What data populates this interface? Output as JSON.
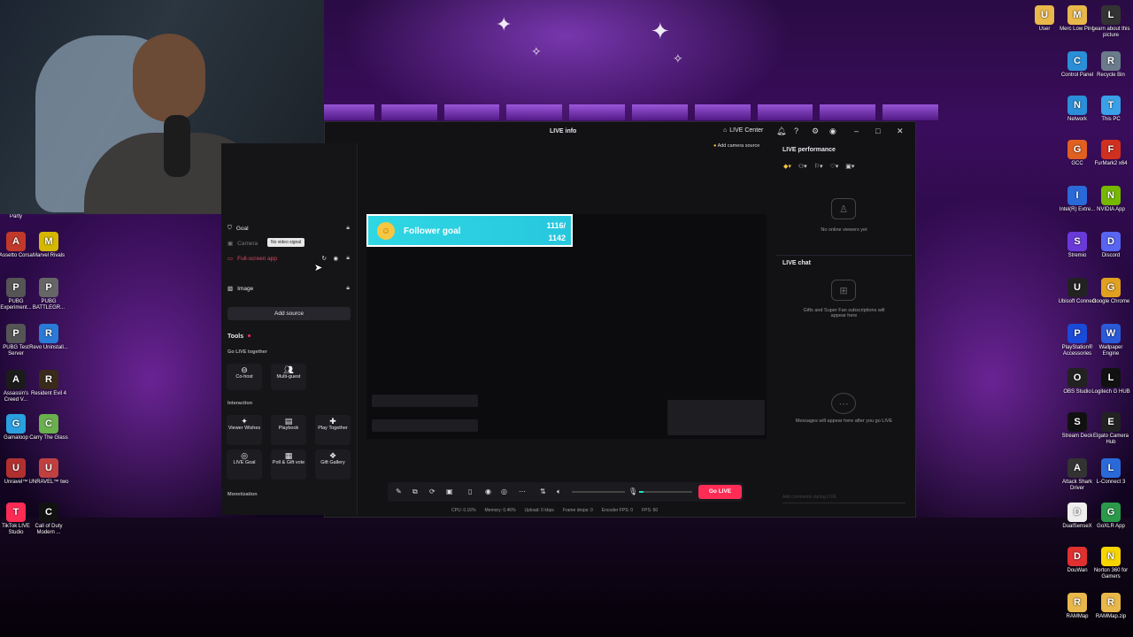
{
  "window": {
    "title": "LIVE info",
    "live_center": "LIVE Center",
    "minimize": "–",
    "maximize": "□",
    "close": "✕"
  },
  "sources": {
    "items": [
      {
        "label": "Goal",
        "icon": "shield-icon"
      },
      {
        "label": "Camera",
        "icon": "camera-icon"
      },
      {
        "label": "Full-screen app",
        "icon": "monitor-icon"
      },
      {
        "label": "Image",
        "icon": "image-icon"
      }
    ],
    "tooltip": "No video signal",
    "add_source": "Add source"
  },
  "tools": {
    "title": "Tools",
    "sections": {
      "go_live_together": "Go LIVE together",
      "interaction": "Interaction",
      "monetization": "Monetization"
    },
    "go_live_together_items": [
      "Co-host",
      "Multi-guest"
    ],
    "interaction_items": [
      "Viewer Wishes",
      "Playbook",
      "Play Together",
      "LIVE Goal",
      "Poll & Gift vote",
      "Gift Gallery"
    ]
  },
  "preview": {
    "goal_label": "Follower goal",
    "goal_current": "1116/",
    "goal_target": "1142",
    "add_camera_source": "Add camera source"
  },
  "controls": {
    "go_live": "Go LIVE",
    "mic_level": 0.08,
    "stats": {
      "cpu": "CPU: 0.16%",
      "memory": "Memory: 0.46%",
      "upload": "Upload: 0 kbps",
      "frame_drops": "Frame drops: 0",
      "encoder_fps": "Encoder FPS: 0",
      "fps": "FPS: 60"
    }
  },
  "right_panel": {
    "performance_title": "LIVE performance",
    "no_viewers": "No online viewers yet",
    "chat_title": "LIVE chat",
    "gifts_note": "Gifts and Super Fan subscriptions will appear here",
    "messages_note": "Messages will appear here after you go LIVE",
    "chat_placeholder": "Add comments during LIVE"
  },
  "desktop": {
    "left_icons": [
      {
        "label": "Party",
        "color": "#444"
      },
      {
        "label": "Assetto Corsa",
        "color": "#c0392b"
      },
      {
        "label": "Marvel Rivals",
        "color": "#d4b800"
      },
      {
        "label": "PUBG Experiment...",
        "color": "#555"
      },
      {
        "label": "PUBG BATTLEGR...",
        "color": "#666"
      },
      {
        "label": "PUBG Test Server",
        "color": "#555"
      },
      {
        "label": "Revo Uninstall...",
        "color": "#2a7ad8"
      },
      {
        "label": "Assassin's Creed V...",
        "color": "#1b1b1b"
      },
      {
        "label": "Resident Evil 4",
        "color": "#3a2a1a"
      },
      {
        "label": "Gamaloop",
        "color": "#2aa0e0"
      },
      {
        "label": "Carry The Glass",
        "color": "#6ab04c"
      },
      {
        "label": "Unravel™",
        "color": "#b03030"
      },
      {
        "label": "UNRAVEL™ two",
        "color": "#c04040"
      },
      {
        "label": "TikTok LIVE Studio",
        "color": "#fe2c55"
      },
      {
        "label": "Call of Duty Modern ...",
        "color": "#111"
      }
    ],
    "right_icons": [
      {
        "label": "User",
        "color": "#e9b84a"
      },
      {
        "label": "Merc Low Ping",
        "color": "#e9b84a"
      },
      {
        "label": "Learn about this picture",
        "color": "#333"
      },
      {
        "label": "Control Panel",
        "color": "#2a8fd8"
      },
      {
        "label": "Recycle Bin",
        "color": "#6b7b8b"
      },
      {
        "label": "Network",
        "color": "#2a8fd8"
      },
      {
        "label": "This PC",
        "color": "#3aa0e8"
      },
      {
        "label": "GCC",
        "color": "#e06020"
      },
      {
        "label": "FurMark2 x64",
        "color": "#d03020"
      },
      {
        "label": "Intel(R) Extre...",
        "color": "#2a6ad8"
      },
      {
        "label": "NVIDIA App",
        "color": "#76b900"
      },
      {
        "label": "Stremio",
        "color": "#6a3ad8"
      },
      {
        "label": "Discord",
        "color": "#5865f2"
      },
      {
        "label": "Ubisoft Connect",
        "color": "#222"
      },
      {
        "label": "Google Chrome",
        "color": "#e0a020"
      },
      {
        "label": "PlayStation® Accessories",
        "color": "#1a4ad8"
      },
      {
        "label": "Wallpaper Engine",
        "color": "#2a5ad8"
      },
      {
        "label": "OBS Studio",
        "color": "#222"
      },
      {
        "label": "Logitech G HUB",
        "color": "#111"
      },
      {
        "label": "Stream Deck",
        "color": "#111"
      },
      {
        "label": "Elgato Camera Hub",
        "color": "#222"
      },
      {
        "label": "Attack Shark Driver",
        "color": "#333"
      },
      {
        "label": "L-Connect 3",
        "color": "#2a6ad8"
      },
      {
        "label": "DualSenseX",
        "color": "#eee"
      },
      {
        "label": "GoXLR App",
        "color": "#2a9a4a"
      },
      {
        "label": "DouWan",
        "color": "#e03030"
      },
      {
        "label": "Norton 360 for Gamers",
        "color": "#f7d500"
      },
      {
        "label": "RAMMap",
        "color": "#e9b84a"
      },
      {
        "label": "RAMMap.zip",
        "color": "#e9b84a"
      }
    ]
  }
}
